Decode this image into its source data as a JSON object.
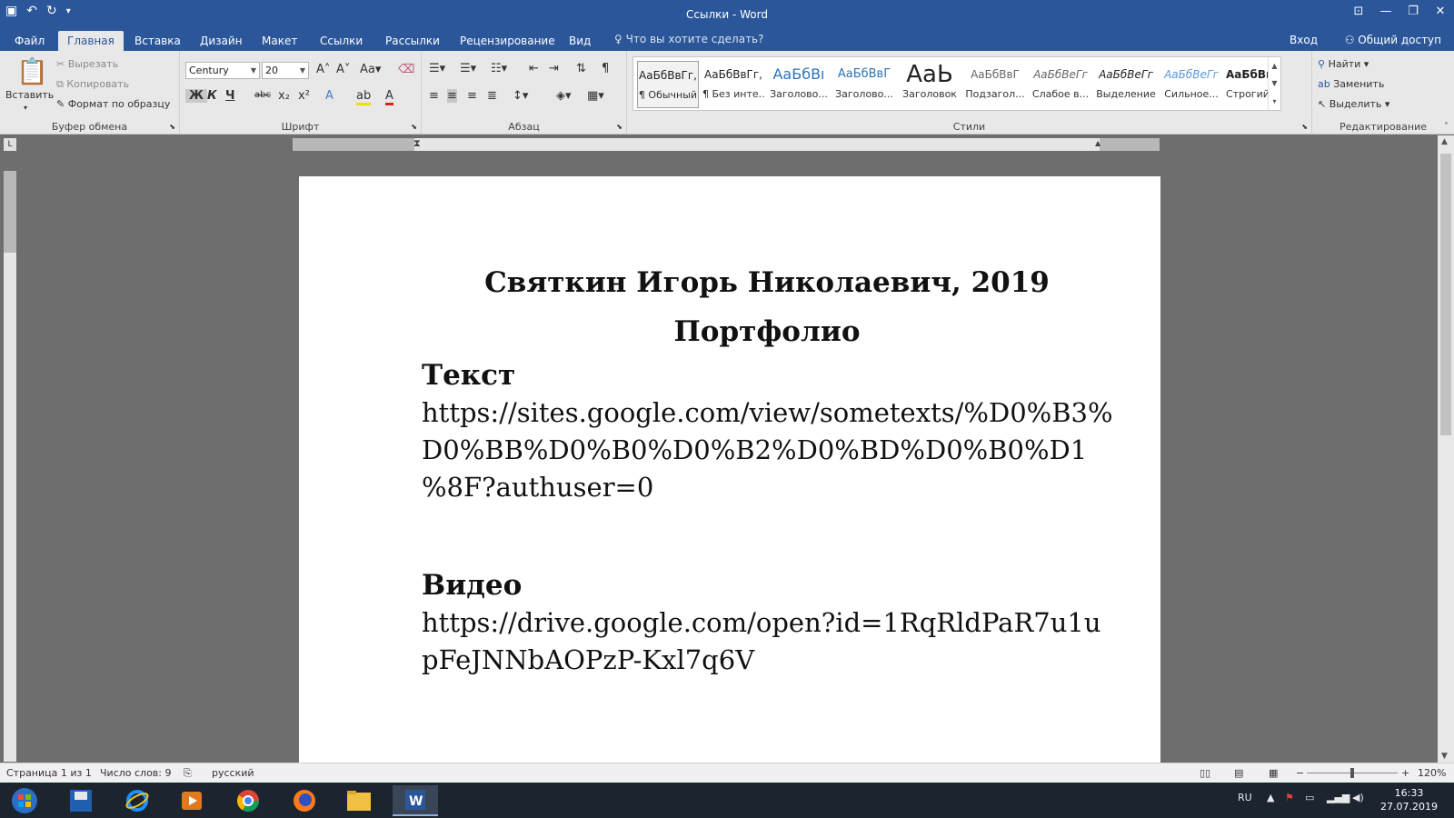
{
  "window": {
    "title": "Ссылки - Word"
  },
  "tabs": [
    "Файл",
    "Главная",
    "Вставка",
    "Дизайн",
    "Макет",
    "Ссылки",
    "Рассылки",
    "Рецензирование",
    "Вид"
  ],
  "tell_me_placeholder": "Что вы хотите сделать?",
  "signin": "Вход",
  "share": "Общий доступ",
  "clipboard": {
    "paste": "Вставить",
    "cut": "Вырезать",
    "copy": "Копировать",
    "format_painter": "Формат по образцу",
    "label": "Буфер обмена"
  },
  "font": {
    "name": "Century",
    "size": "20",
    "label": "Шрифт",
    "change_case": "Aa",
    "bold": "Ж",
    "italic": "К",
    "underline": "Ч",
    "strike": "abc",
    "sub": "x₂",
    "sup": "x²"
  },
  "paragraph": {
    "label": "Абзац"
  },
  "styles": {
    "label": "Стили",
    "items": [
      {
        "preview": "АаБбВвГг,",
        "name": "¶ Обычный"
      },
      {
        "preview": "АаБбВвГг,",
        "name": "¶ Без инте..."
      },
      {
        "preview": "АаБбВı",
        "name": "Заголово..."
      },
      {
        "preview": "АаБбВвГ",
        "name": "Заголово..."
      },
      {
        "preview": "АаЬ",
        "name": "Заголовок"
      },
      {
        "preview": "АаБбВвГ",
        "name": "Подзагол..."
      },
      {
        "preview": "АаБбВеГг",
        "name": "Слабое в..."
      },
      {
        "preview": "АаБбВеГг",
        "name": "Выделение"
      },
      {
        "preview": "АаБбВеГг",
        "name": "Сильное..."
      },
      {
        "preview": "АаБбВвГг,",
        "name": "Строгий"
      }
    ]
  },
  "editing": {
    "find": "Найти",
    "replace": "Заменить",
    "select": "Выделить",
    "label": "Редактирование"
  },
  "document": {
    "title": "Святкин Игорь Николаевич, 2019",
    "subtitle": "Портфолио",
    "section1_heading": "Текст",
    "section1_link_1": "https://sites.google.com/view/sometexts/%D0%B3%",
    "section1_link_2": "D0%BB%D0%B0%D0%B2%D0%BD%D0%B0%D1",
    "section1_link_3": "%8F?authuser=0",
    "section2_heading": "Видео",
    "section2_link_1": "https://drive.google.com/open?id=1RqRldPaR7u1u",
    "section2_link_2": "pFeJNNbAOPzP-Kxl7q6V"
  },
  "status": {
    "page": "Страница 1 из 1",
    "words": "Число слов: 9",
    "language": "русский",
    "zoom": "120%"
  },
  "taskbar": {
    "lang": "RU",
    "time": "16:33",
    "date": "27.07.2019"
  },
  "colors": {
    "word_blue": "#2b579a",
    "ribbon_bg": "#e8e8e8"
  }
}
